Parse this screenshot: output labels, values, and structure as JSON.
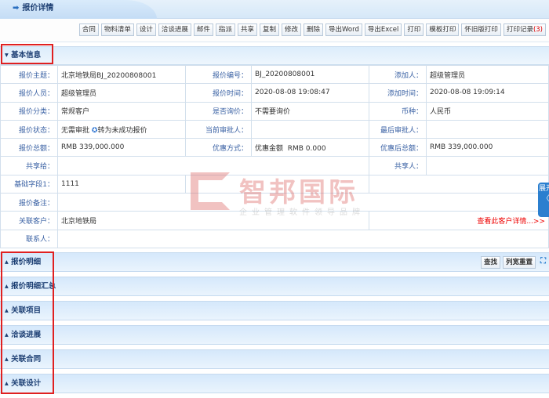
{
  "header": {
    "title": "报价详情"
  },
  "toolbar": [
    "合同",
    "物料清单",
    "设计",
    "洽谈进展",
    "邮件",
    "指派",
    "共享",
    "复制",
    "修改",
    "删除",
    "导出Word",
    "导出Excel",
    "打印",
    "模板打印",
    "怀旧版打印"
  ],
  "print_log": {
    "label": "打印记录",
    "count": "(3)"
  },
  "basic": {
    "title": "基本信息",
    "subject_l": "报价主题：",
    "subject": "北京地铁局BJ_20200808001",
    "no_l": "报价编号：",
    "no": "BJ_20200808001",
    "adder_l": "添加人：",
    "adder": "超级管理员",
    "person_l": "报价人员：",
    "person": "超级管理员",
    "time_l": "报价时间：",
    "time": "2020-08-08 19:08:47",
    "addtime_l": "添加时间：",
    "addtime": "2020-08-08 19:09:14",
    "cat_l": "报价分类：",
    "cat": "常规客户",
    "inquiry_l": "是否询价：",
    "inquiry": "不需要询价",
    "currency_l": "币种：",
    "currency": "人民币",
    "status_l": "报价状态：",
    "status": "无需审批",
    "status_action": "转为未成功报价",
    "cur_approver_l": "当前审批人：",
    "last_approver_l": "最后审批人：",
    "total_l": "报价总额：",
    "total": "RMB 339,000.000",
    "discount_l": "优惠方式：",
    "discount_type": "优惠金额",
    "discount": "RMB 0.000",
    "after_l": "优惠后总额：",
    "after": "RMB 339,000.000",
    "share_to_l": "共享给：",
    "sharer_l": "共享人：",
    "field1_l": "基础字段1：",
    "field1": "1111",
    "remark_l": "报价备注：",
    "customer_l": "关联客户：",
    "customer": "北京地铁局",
    "customer_link": "查看此客户详情...>>",
    "contact_l": "联系人："
  },
  "watermark": {
    "name": "智邦国际",
    "slogan": "企业管理软件领导品牌"
  },
  "sections": [
    "报价明细",
    "报价明细汇总",
    "关联项目",
    "洽谈进展",
    "关联合同",
    "关联设计"
  ],
  "detail_tools": {
    "search": "查找",
    "reset": "列宽重置"
  },
  "side_tab": {
    "label": "展开",
    "arrow": "〈"
  }
}
